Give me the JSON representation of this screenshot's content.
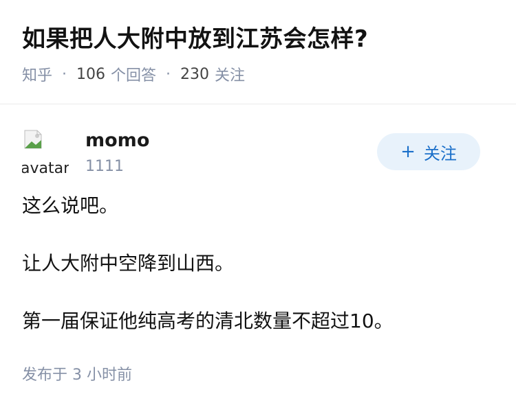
{
  "question": {
    "title": "如果把人大附中放到江苏会怎样?",
    "source": "知乎",
    "separator": "·",
    "answer_count": "106",
    "answer_label": "个回答",
    "follower_count": "230",
    "follower_label": "关注"
  },
  "answer": {
    "author": {
      "name": "momo",
      "subtitle": "1111",
      "avatar_alt": "avatar"
    },
    "follow_button": {
      "icon": "+",
      "label": "关注"
    },
    "paragraphs": [
      "这么说吧。",
      "让人大附中空降到山西。",
      "第一届保证他纯高考的清北数量不超过10。"
    ],
    "published": "发布于 3 小时前"
  },
  "colors": {
    "meta_gray": "#8590a6",
    "follow_bg": "#e8f2fb",
    "follow_text": "#1a6fc9"
  }
}
